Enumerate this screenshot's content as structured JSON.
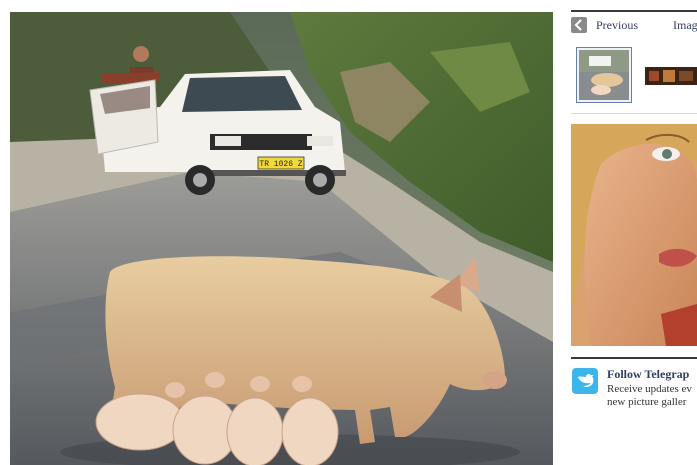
{
  "photo": {
    "plate_text": "TR 1026 Z"
  },
  "sidebar": {
    "nav": {
      "previous_label": "Previous",
      "images_label": "Image"
    },
    "follow": {
      "title": "Follow Telegrap",
      "line1": "Receive updates ev",
      "line2": "new picture galler"
    }
  }
}
